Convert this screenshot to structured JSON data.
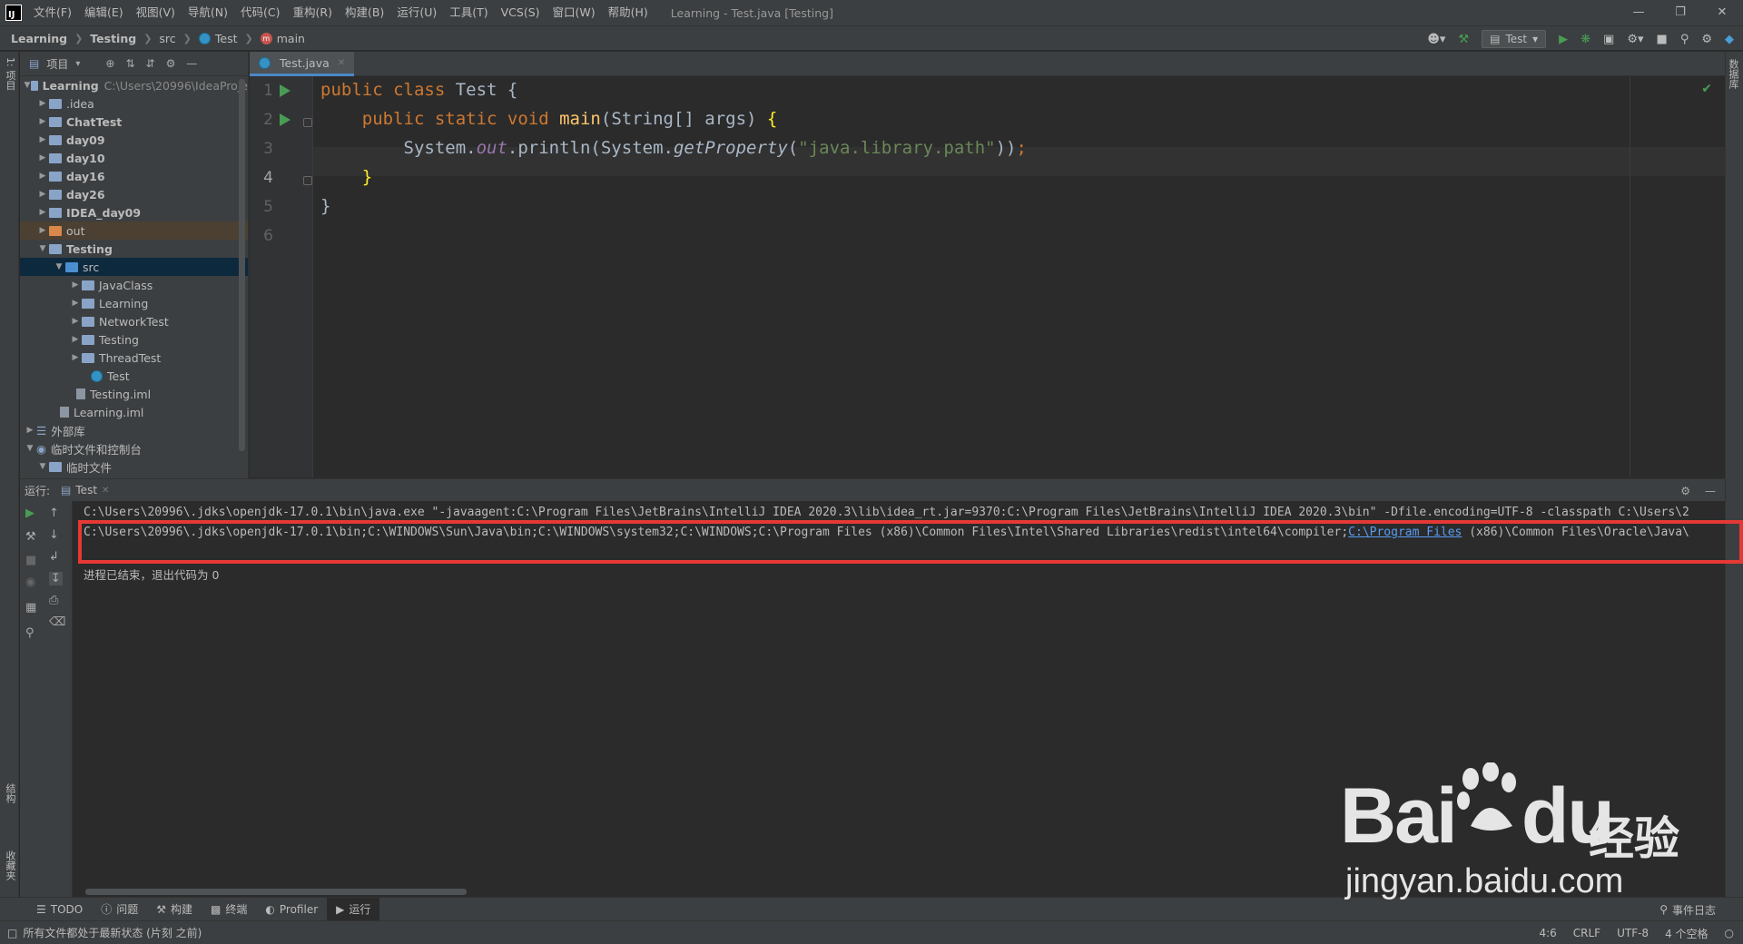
{
  "titlebar": {
    "menu": [
      "文件(F)",
      "编辑(E)",
      "视图(V)",
      "导航(N)",
      "代码(C)",
      "重构(R)",
      "构建(B)",
      "运行(U)",
      "工具(T)",
      "VCS(S)",
      "窗口(W)",
      "帮助(H)"
    ],
    "window_title": "Learning - Test.java [Testing]"
  },
  "navbar": {
    "crumbs": [
      "Learning",
      "Testing",
      "src",
      "Test",
      "main"
    ],
    "run_config": "Test"
  },
  "left_strip": {
    "top_label": "1: 项目",
    "bottom_label1": "结构",
    "bottom_label2": "收藏夹"
  },
  "right_strip": {
    "label": "数据库"
  },
  "project": {
    "header_title": "项目",
    "tree": [
      {
        "label": "Learning",
        "path": "C:\\Users\\20996\\IdeaProje",
        "bold": true
      },
      {
        "label": ".idea"
      },
      {
        "label": "ChatTest",
        "bold": true
      },
      {
        "label": "day09",
        "bold": true
      },
      {
        "label": "day10",
        "bold": true
      },
      {
        "label": "day16",
        "bold": true
      },
      {
        "label": "day26",
        "bold": true
      },
      {
        "label": "IDEA_day09",
        "bold": true
      },
      {
        "label": "out"
      },
      {
        "label": "Testing",
        "bold": true
      },
      {
        "label": "src"
      },
      {
        "label": "JavaClass"
      },
      {
        "label": "Learning"
      },
      {
        "label": "NetworkTest"
      },
      {
        "label": "Testing"
      },
      {
        "label": "ThreadTest"
      },
      {
        "label": "Test"
      },
      {
        "label": "Testing.iml"
      },
      {
        "label": "Learning.iml"
      },
      {
        "label": "外部库"
      },
      {
        "label": "临时文件和控制台"
      },
      {
        "label": "临时文件"
      }
    ]
  },
  "editor": {
    "tab": "Test.java",
    "line_numbers": [
      "1",
      "2",
      "3",
      "4",
      "5",
      "6"
    ]
  },
  "run": {
    "header_label": "运行:",
    "tab": "Test",
    "console": {
      "line1": "C:\\Users\\20996\\.jdks\\openjdk-17.0.1\\bin\\java.exe \"-javaagent:C:\\Program Files\\JetBrains\\IntelliJ IDEA 2020.3\\lib\\idea_rt.jar=9370:C:\\Program Files\\JetBrains\\IntelliJ IDEA 2020.3\\bin\" -Dfile.encoding=UTF-8 -classpath C:\\Users\\2",
      "line2_pre": "C:\\Users\\20996\\.jdks\\openjdk-17.0.1\\bin;C:\\WINDOWS\\Sun\\Java\\bin;C:\\WINDOWS\\system32;C:\\WINDOWS;C:\\Program Files (x86)\\Common Files\\Intel\\Shared Libraries\\redist\\intel64\\compiler;",
      "line2_link": "C:\\Program Files",
      "line2_post": " (x86)\\Common Files\\Oracle\\Java\\",
      "exit": "进程已结束，退出代码为 0"
    }
  },
  "tool_tabs": [
    "TODO",
    "问题",
    "构建",
    "终端",
    "Profiler",
    "运行"
  ],
  "event_log": "事件日志",
  "status": {
    "message": "所有文件都处于最新状态 (片刻 之前)",
    "position": "4:6",
    "line_sep": "CRLF",
    "encoding": "UTF-8",
    "indent": "4 个空格"
  },
  "watermark": {
    "bai": "Bai",
    "du": "du",
    "jingyan": "经验",
    "url": "jingyan.baidu.com"
  }
}
